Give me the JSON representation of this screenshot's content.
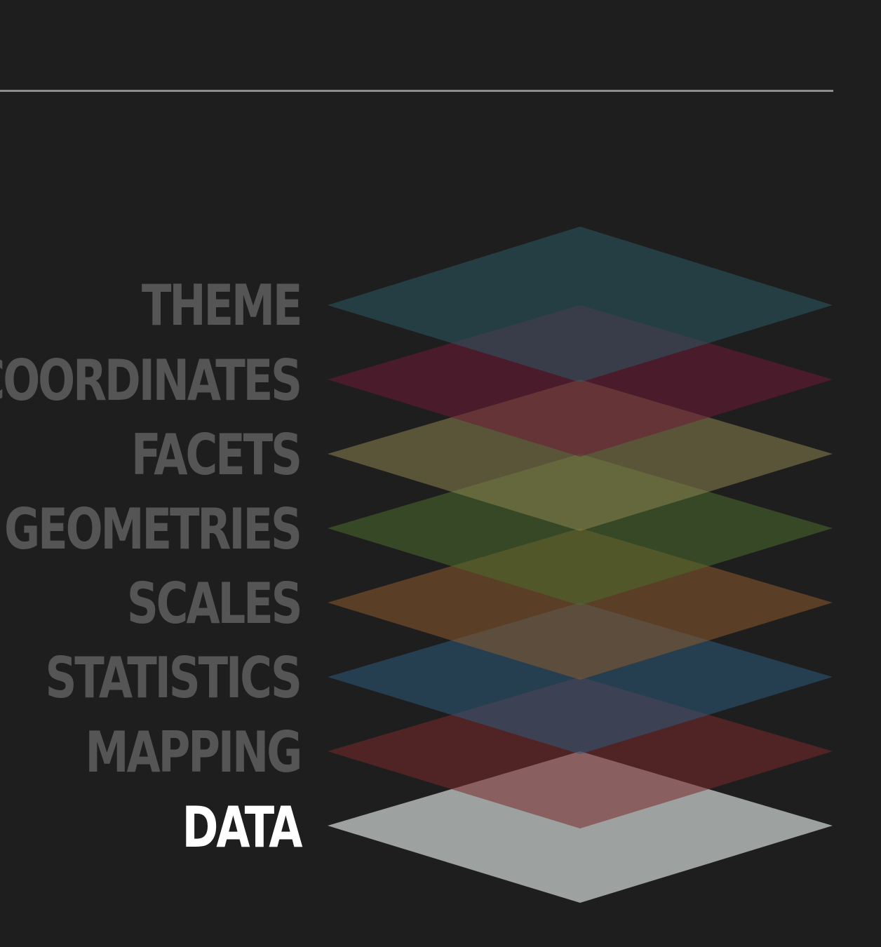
{
  "layers": [
    {
      "label": "THEME",
      "color": "#2c5a63",
      "active": false
    },
    {
      "label": "COORDINATES",
      "color": "#6e1a36",
      "active": false
    },
    {
      "label": "FACETS",
      "color": "#8c8450",
      "active": false
    },
    {
      "label": "GEOMETRIES",
      "color": "#4d6b2e",
      "active": false
    },
    {
      "label": "SCALES",
      "color": "#8c5a2c",
      "active": false
    },
    {
      "label": "STATISTICS",
      "color": "#2c5a7a",
      "active": false
    },
    {
      "label": "MAPPING",
      "color": "#7a2a2a",
      "active": false
    },
    {
      "label": "DATA",
      "color": "#9da1a0",
      "active": true
    }
  ]
}
